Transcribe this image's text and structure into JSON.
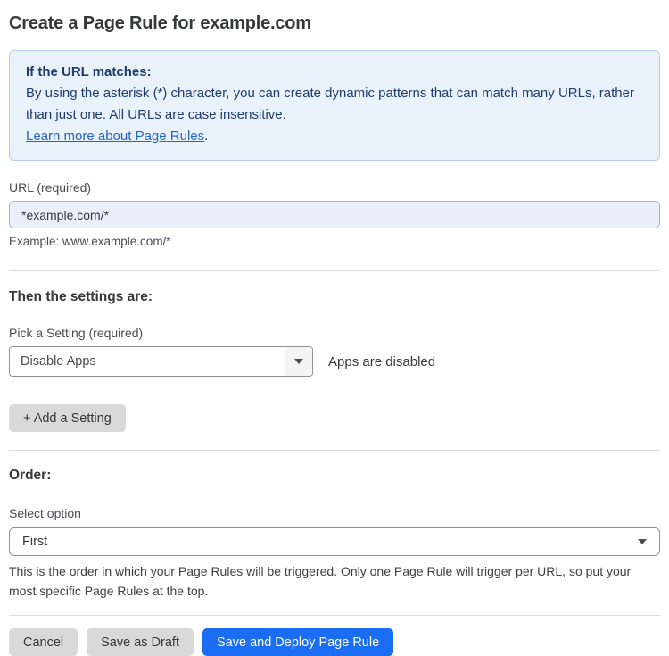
{
  "page": {
    "title": "Create a Page Rule for example.com"
  },
  "info_box": {
    "heading": "If the URL matches:",
    "body": "By using the asterisk (*) character, you can create dynamic patterns that can match many URLs, rather than just one. All URLs are case insensitive.",
    "link_label": "Learn more about Page Rules",
    "link_suffix": "."
  },
  "url_field": {
    "label": "URL (required)",
    "value": "*example.com/*",
    "helper": "Example: www.example.com/*"
  },
  "settings_section": {
    "heading": "Then the settings are:",
    "setting_label": "Pick a Setting (required)",
    "setting_value": "Disable Apps",
    "setting_status": "Apps are disabled",
    "add_setting_label": "+ Add a Setting"
  },
  "order_section": {
    "heading": "Order:",
    "select_label": "Select option",
    "select_value": "First",
    "helper": "This is the order in which your Page Rules will be triggered. Only one Page Rule will trigger per URL, so put your most specific Page Rules at the top."
  },
  "actions": {
    "cancel_label": "Cancel",
    "save_draft_label": "Save as Draft",
    "save_deploy_label": "Save and Deploy Page Rule"
  },
  "icons": {
    "setting_dropdown_caret": "chevron-down-icon",
    "order_select_caret": "chevron-down-icon"
  },
  "colors": {
    "info_background": "#e9f1fb",
    "info_border": "#b3cdea",
    "info_text": "#1e3c6d",
    "link_blue": "#2563c4",
    "url_input_background": "#e9f0fc",
    "primary_button_blue": "#1b6ef3",
    "secondary_button_gray": "#d9d9d9",
    "text_dark": "#36373a"
  }
}
